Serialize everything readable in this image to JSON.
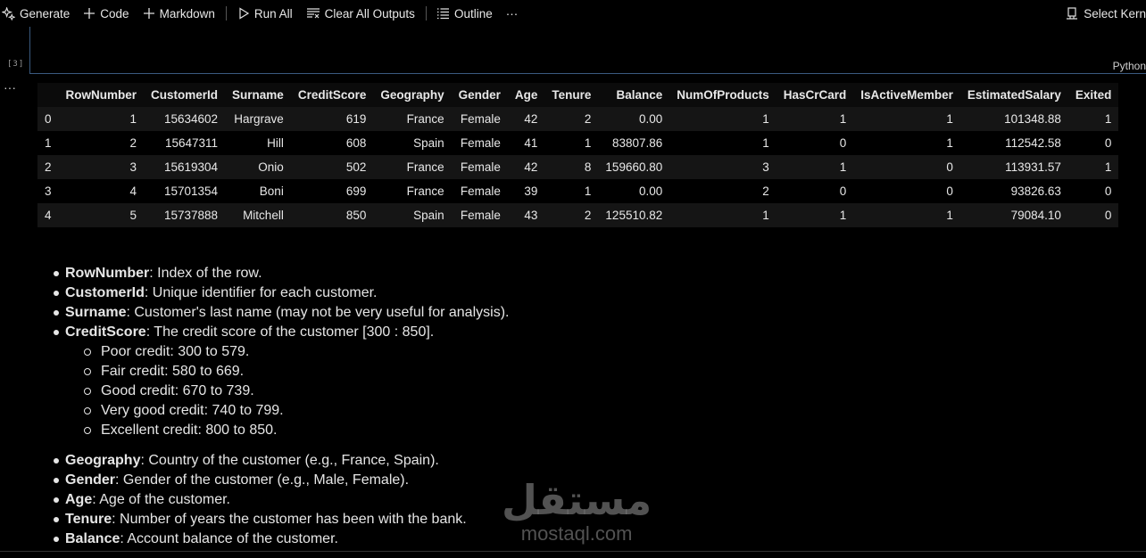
{
  "toolbar": {
    "generate": "Generate",
    "code": "Code",
    "markdown": "Markdown",
    "run_all": "Run All",
    "clear_outputs": "Clear All Outputs",
    "outline": "Outline",
    "more": "···",
    "select_kernel": "Select Kern"
  },
  "cell": {
    "exec_count": "[3]",
    "language": "Python",
    "output_menu": "···"
  },
  "table": {
    "columns": [
      "",
      "RowNumber",
      "CustomerId",
      "Surname",
      "CreditScore",
      "Geography",
      "Gender",
      "Age",
      "Tenure",
      "Balance",
      "NumOfProducts",
      "HasCrCard",
      "IsActiveMember",
      "EstimatedSalary",
      "Exited"
    ],
    "rows": [
      [
        "0",
        "1",
        "15634602",
        "Hargrave",
        "619",
        "France",
        "Female",
        "42",
        "2",
        "0.00",
        "1",
        "1",
        "1",
        "101348.88",
        "1"
      ],
      [
        "1",
        "2",
        "15647311",
        "Hill",
        "608",
        "Spain",
        "Female",
        "41",
        "1",
        "83807.86",
        "1",
        "0",
        "1",
        "112542.58",
        "0"
      ],
      [
        "2",
        "3",
        "15619304",
        "Onio",
        "502",
        "France",
        "Female",
        "42",
        "8",
        "159660.80",
        "3",
        "1",
        "0",
        "113931.57",
        "1"
      ],
      [
        "3",
        "4",
        "15701354",
        "Boni",
        "699",
        "France",
        "Female",
        "39",
        "1",
        "0.00",
        "2",
        "0",
        "0",
        "93826.63",
        "0"
      ],
      [
        "4",
        "5",
        "15737888",
        "Mitchell",
        "850",
        "Spain",
        "Female",
        "43",
        "2",
        "125510.82",
        "1",
        "1",
        "1",
        "79084.10",
        "0"
      ]
    ]
  },
  "markdown": {
    "rownumber": {
      "term": "RowNumber",
      "desc": ": Index of the row."
    },
    "customerid": {
      "term": "CustomerId",
      "desc": ": Unique identifier for each customer."
    },
    "surname": {
      "term": "Surname",
      "desc": ": Customer's last name (may not be very useful for analysis)."
    },
    "creditscore": {
      "term": "CreditScore",
      "desc": ": The credit score of the customer [300 : 850]."
    },
    "credit_ranges": [
      "Poor credit: 300 to 579.",
      "Fair credit: 580 to 669.",
      "Good credit: 670 to 739.",
      "Very good credit: 740 to 799.",
      "Excellent credit: 800 to 850."
    ],
    "geography": {
      "term": "Geography",
      "desc": ": Country of the customer (e.g., France, Spain)."
    },
    "gender": {
      "term": "Gender",
      "desc": ": Gender of the customer (e.g., Male, Female)."
    },
    "age": {
      "term": "Age",
      "desc": ": Age of the customer."
    },
    "tenure": {
      "term": "Tenure",
      "desc": ": Number of years the customer has been with the bank."
    },
    "balance": {
      "term": "Balance",
      "desc": ": Account balance of the customer."
    }
  },
  "watermark": {
    "arabic": "مستقل",
    "latin": "mostaql.com"
  }
}
